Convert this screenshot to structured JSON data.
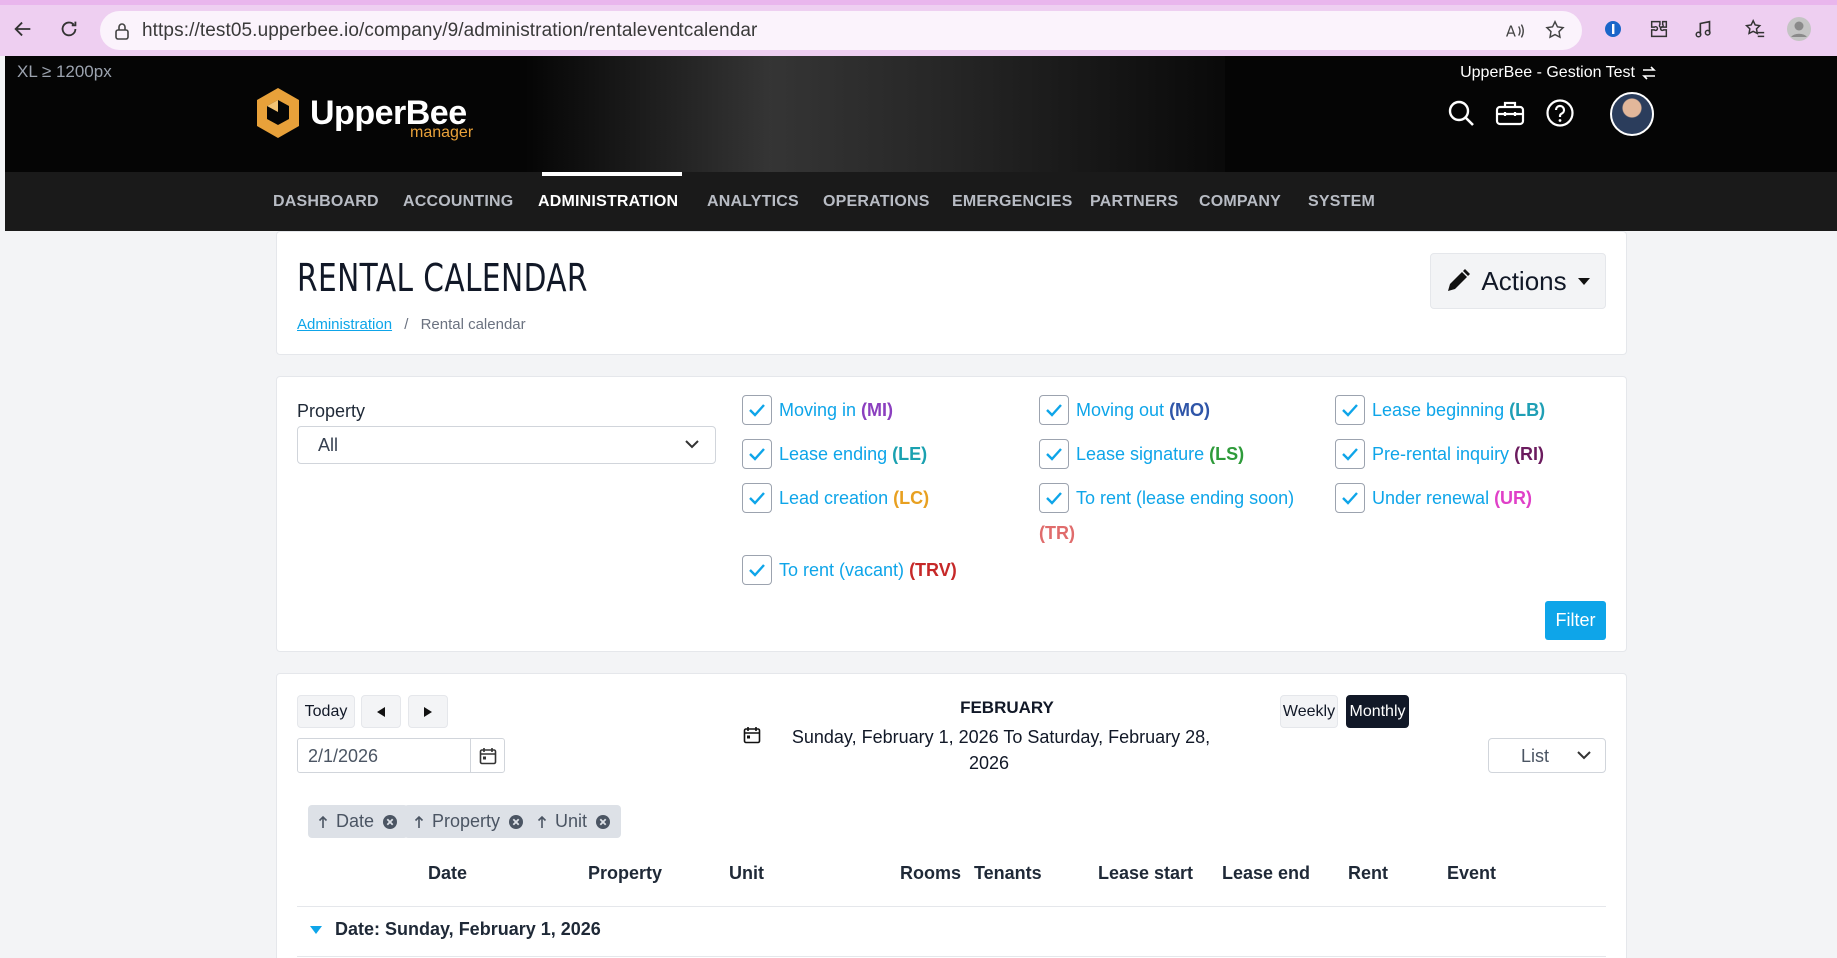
{
  "browser": {
    "url": "https://test05.upperbee.io/company/9/administration/rentaleventcalendar"
  },
  "header": {
    "breakpoint_label": "XL ≥ 1200px",
    "brand_name": "UpperBee",
    "brand_sub": "manager",
    "company": "UpperBee - Gestion Test"
  },
  "nav": {
    "items": [
      "DASHBOARD",
      "ACCOUNTING",
      "ADMINISTRATION",
      "ANALYTICS",
      "OPERATIONS",
      "EMERGENCIES",
      "PARTNERS",
      "COMPANY",
      "SYSTEM"
    ],
    "active": "ADMINISTRATION"
  },
  "page": {
    "title": "RENTAL CALENDAR",
    "breadcrumb_parent": "Administration",
    "breadcrumb_sep": "/",
    "breadcrumb_current": "Rental calendar",
    "actions_label": "Actions"
  },
  "filters": {
    "property_label": "Property",
    "property_value": "All",
    "events": [
      {
        "label": "Moving in",
        "code": "(MI)",
        "color": "#8b3fbf",
        "checked": true
      },
      {
        "label": "Moving out",
        "code": "(MO)",
        "color": "#2f55a8",
        "checked": true
      },
      {
        "label": "Lease beginning",
        "code": "(LB)",
        "color": "#1f9fb5",
        "checked": true
      },
      {
        "label": "Lease ending",
        "code": "(LE)",
        "color": "#1aa1b0",
        "checked": true
      },
      {
        "label": "Lease signature",
        "code": "(LS)",
        "color": "#2e9b3a",
        "checked": true
      },
      {
        "label": "Pre-rental inquiry",
        "code": "(RI)",
        "color": "#6b1b5e",
        "checked": true
      },
      {
        "label": "Lead creation",
        "code": "(LC)",
        "color": "#e8a020",
        "checked": true
      },
      {
        "label": "To rent (lease ending soon)",
        "code": "(TR)",
        "color": "#e06c6c",
        "checked": true
      },
      {
        "label": "Under renewal",
        "code": "(UR)",
        "color": "#e040c8",
        "checked": true
      },
      {
        "label": "To rent (vacant)",
        "code": "(TRV)",
        "color": "#c62828",
        "checked": true
      }
    ],
    "filter_button": "Filter"
  },
  "calendar": {
    "today_label": "Today",
    "date_value": "2/1/2026",
    "month": "FEBRUARY",
    "range_line1": "Sunday, February 1, 2026 To Saturday, February 28,",
    "range_line2": "2026",
    "weekly_label": "Weekly",
    "monthly_label": "Monthly",
    "active_view": "Monthly",
    "view_mode": "List",
    "sort_chips": [
      "Date",
      "Property",
      "Unit"
    ],
    "columns": [
      "Date",
      "Property",
      "Unit",
      "Rooms",
      "Tenants",
      "Lease start",
      "Lease end",
      "Rent",
      "Event"
    ],
    "group_label": "Date: Sunday, February 1, 2026"
  },
  "colors": {
    "accent": "#0ea5e9",
    "nav_bg": "#1a1a1a",
    "brand_orange": "#e8a13a"
  }
}
